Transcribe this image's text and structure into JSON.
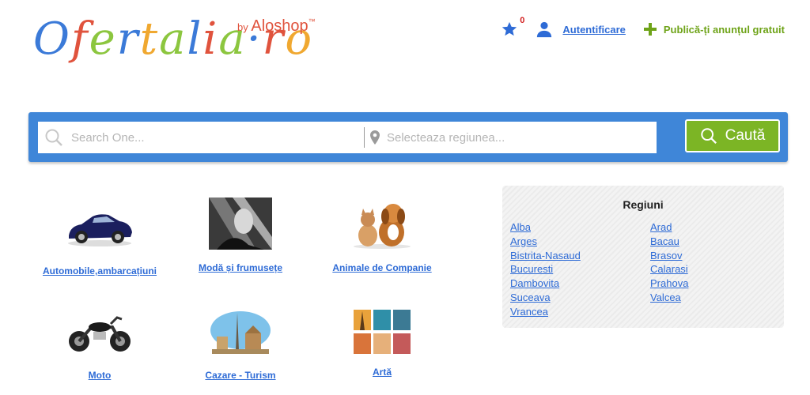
{
  "header": {
    "logo": {
      "letters": [
        {
          "char": "O",
          "color": "#3b7ad8"
        },
        {
          "char": "f",
          "color": "#e0533d"
        },
        {
          "char": "e",
          "color": "#8cc63f"
        },
        {
          "char": "r",
          "color": "#3b7ad8"
        },
        {
          "char": "t",
          "color": "#f0a830"
        },
        {
          "char": "a",
          "color": "#8cc63f"
        },
        {
          "char": "l",
          "color": "#3b7ad8"
        },
        {
          "char": "i",
          "color": "#e0533d"
        },
        {
          "char": "a",
          "color": "#8cc63f"
        },
        {
          "char": "·",
          "color": "#3b7ad8"
        },
        {
          "char": "r",
          "color": "#e0533d"
        },
        {
          "char": "o",
          "color": "#f0a830"
        }
      ],
      "by_text": "by",
      "brand_text": "Aloshop",
      "tm": "™"
    },
    "favorites_count": "0",
    "login_label": "Autentificare",
    "publish_label": "Publică-ți anunțul gratuit"
  },
  "search": {
    "placeholder": "Search One...",
    "region_placeholder": "Selecteaza regiunea...",
    "button_label": "Caută"
  },
  "categories": [
    {
      "label": "Automobile,ambarcațiuni",
      "icon": "sports-car"
    },
    {
      "label": "Modă și frumusețe",
      "icon": "fashion-portrait"
    },
    {
      "label": "Animale de Companie",
      "icon": "cat-and-dog"
    },
    {
      "label": "Moto",
      "icon": "motorcycle"
    },
    {
      "label": "Cazare - Turism",
      "icon": "landmarks"
    },
    {
      "label": "Artă",
      "icon": "paintings"
    }
  ],
  "regions": {
    "title": "Regiuni",
    "left": [
      "Alba",
      "Arges",
      "Bistrita-Nasaud",
      "Bucuresti",
      "Dambovita",
      "Suceava",
      "Vrancea"
    ],
    "right": [
      "Arad",
      "Bacau",
      "Brasov",
      "Calarasi",
      "Prahova",
      "Valcea"
    ]
  },
  "colors": {
    "accent_blue": "#3f86d8",
    "link_blue": "#2e6bd6",
    "green": "#7cb525",
    "badge_red": "#d21f1f"
  }
}
